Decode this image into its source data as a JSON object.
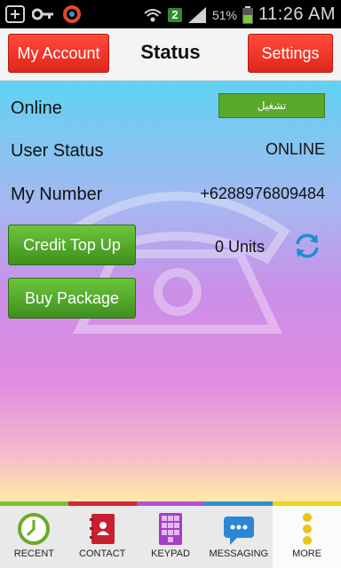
{
  "status_bar": {
    "notification_badge": "2",
    "battery_percent": "51%",
    "time": "11:26 AM"
  },
  "header": {
    "left_button": "My Account",
    "title": "Status",
    "right_button": "Settings"
  },
  "status": {
    "online_label": "Online",
    "online_toggle": "تشغيل",
    "user_status_label": "User Status",
    "user_status_value": "ONLINE",
    "my_number_label": "My Number",
    "my_number_value": "+6288976809484",
    "credit_top_up_button": "Credit Top Up",
    "units": "0 Units",
    "buy_package_button": "Buy Package"
  },
  "tabs": [
    {
      "label": "RECENT",
      "color": "#7cbf35"
    },
    {
      "label": "CONTACT",
      "color": "#d0263a"
    },
    {
      "label": "KEYPAD",
      "color": "#b84fd1"
    },
    {
      "label": "MESSAGING",
      "color": "#2e8fd8"
    },
    {
      "label": "MORE",
      "color": "#f0d21a"
    }
  ]
}
